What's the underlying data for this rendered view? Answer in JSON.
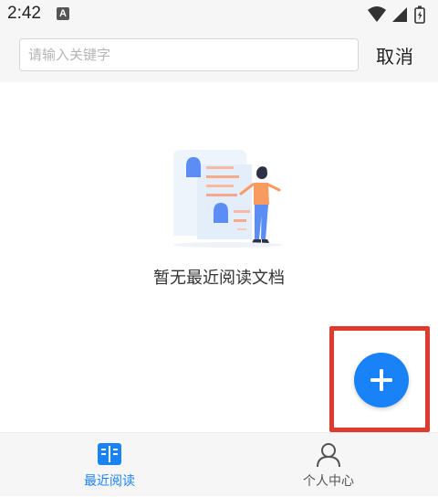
{
  "status_bar": {
    "time": "2:42",
    "notification_badge": "A",
    "icons": [
      "wifi-icon",
      "cellular-signal-icon",
      "battery-icon"
    ]
  },
  "search": {
    "placeholder": "请输入关键字",
    "value": "",
    "cancel_label": "取消"
  },
  "empty_state": {
    "message": "暂无最近阅读文档",
    "icon": "empty-documents-illustration"
  },
  "fab": {
    "icon": "plus-icon",
    "color": "#1a82f7"
  },
  "highlight": {
    "color": "#e1392d"
  },
  "bottom_nav": {
    "items": [
      {
        "label": "最近阅读",
        "icon": "open-book-icon",
        "active": true
      },
      {
        "label": "个人中心",
        "icon": "person-icon",
        "active": false
      }
    ]
  },
  "colors": {
    "accent": "#1a82f7",
    "bar_background": "#f6f6f6"
  }
}
